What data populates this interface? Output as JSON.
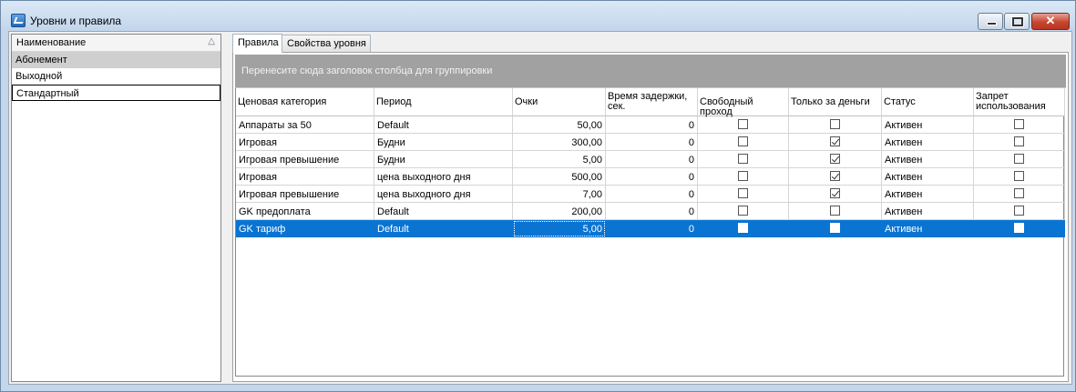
{
  "window": {
    "title": "Уровни и правила",
    "icon": "app-window-icon",
    "controls": {
      "minimize": "minimize-icon",
      "maximize": "maximize-icon",
      "close_symbol": "✕"
    }
  },
  "left_list": {
    "header": "Наименование",
    "sort_symbol": "△",
    "items": [
      {
        "label": "Абонемент",
        "state": "selected"
      },
      {
        "label": "Выходной",
        "state": "normal"
      },
      {
        "label": "Стандартный",
        "state": "focused"
      }
    ]
  },
  "tabs": [
    {
      "label": "Правила",
      "active": true
    },
    {
      "label": "Свойства уровня",
      "active": false
    }
  ],
  "grid": {
    "group_hint": "Перенесите сюда заголовок столбца для группировки",
    "columns": [
      "Ценовая категория",
      "Период",
      "Очки",
      "Время задержки, сек.",
      "Свободный проход",
      "Только за деньги",
      "Статус",
      "Запрет использования"
    ],
    "rows": [
      {
        "category": "Аппараты за 50",
        "period": "Default",
        "points": "50,00",
        "delay": "0",
        "free_pass": false,
        "money_only": false,
        "status": "Активен",
        "ban": false,
        "selected": false
      },
      {
        "category": "Игровая",
        "period": "Будни",
        "points": "300,00",
        "delay": "0",
        "free_pass": false,
        "money_only": true,
        "status": "Активен",
        "ban": false,
        "selected": false
      },
      {
        "category": "Игровая превышение",
        "period": "Будни",
        "points": "5,00",
        "delay": "0",
        "free_pass": false,
        "money_only": true,
        "status": "Активен",
        "ban": false,
        "selected": false
      },
      {
        "category": "Игровая",
        "period": "цена выходного дня",
        "points": "500,00",
        "delay": "0",
        "free_pass": false,
        "money_only": true,
        "status": "Активен",
        "ban": false,
        "selected": false
      },
      {
        "category": "Игровая превышение",
        "period": "цена выходного дня",
        "points": "7,00",
        "delay": "0",
        "free_pass": false,
        "money_only": true,
        "status": "Активен",
        "ban": false,
        "selected": false
      },
      {
        "category": "GK  предоплата",
        "period": "Default",
        "points": "200,00",
        "delay": "0",
        "free_pass": false,
        "money_only": false,
        "status": "Активен",
        "ban": false,
        "selected": false
      },
      {
        "category": "GK тариф",
        "period": "Default",
        "points": "5,00",
        "delay": "0",
        "free_pass": false,
        "money_only": false,
        "status": "Активен",
        "ban": false,
        "selected": true
      }
    ]
  },
  "colors": {
    "selection": "#0a74d2",
    "group_area": "#a1a1a1",
    "frame": "#c3d6ea",
    "close_button": "#c54631"
  }
}
